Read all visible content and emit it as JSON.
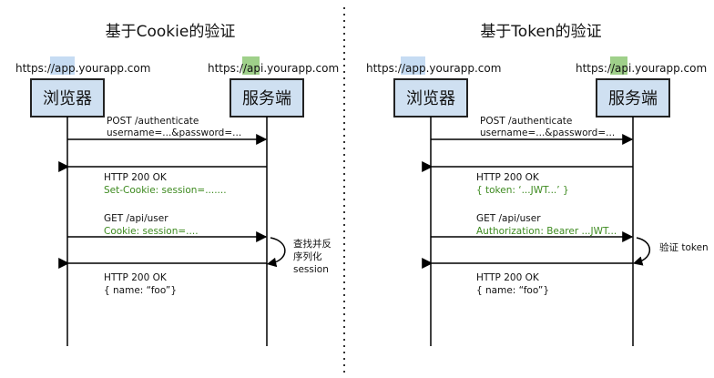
{
  "colors": {
    "box_fill": "#cfe0f1",
    "box_stroke": "#222222",
    "highlight_app": "#c6dcf3",
    "highlight_api": "#9fd08a",
    "green_text": "#3d8a1f",
    "line": "#000000"
  },
  "panels": [
    {
      "title": "基于Cookie的验证",
      "client_host": {
        "prefix": "https://",
        "sub": "app",
        "suffix": ".yourapp.com"
      },
      "server_host": {
        "prefix": "https://",
        "sub": "api",
        "suffix": ".yourapp.com"
      },
      "client_label": "浏览器",
      "server_label": "服务端",
      "messages": [
        {
          "line1": "POST /authenticate",
          "line2": "username=...&password=..."
        },
        {
          "line1": "HTTP 200 OK",
          "line2": "Set-Cookie: session=......."
        },
        {
          "line1": "GET /api/user",
          "line2": "Cookie: session=...."
        },
        {
          "line1": "HTTP 200 OK",
          "line2": "{  name: “foo”}"
        }
      ],
      "process_note": [
        "查找并反",
        "序列化",
        "session"
      ]
    },
    {
      "title": "基于Token的验证",
      "client_host": {
        "prefix": "https://",
        "sub": "app",
        "suffix": ".yourapp.com"
      },
      "server_host": {
        "prefix": "https://",
        "sub": "api",
        "suffix": ".yourapp.com"
      },
      "client_label": "浏览器",
      "server_label": "服务端",
      "messages": [
        {
          "line1": "POST /authenticate",
          "line2": "username=...&password=..."
        },
        {
          "line1": "HTTP 200 OK",
          "line2": "{ token: ‘...JWT...’ }"
        },
        {
          "line1": "GET /api/user",
          "line2": "Authorization: Bearer ...JWT..."
        },
        {
          "line1": "HTTP 200 OK",
          "line2": "{ name: “foo”}"
        }
      ],
      "process_note": [
        "验证 token"
      ]
    }
  ]
}
